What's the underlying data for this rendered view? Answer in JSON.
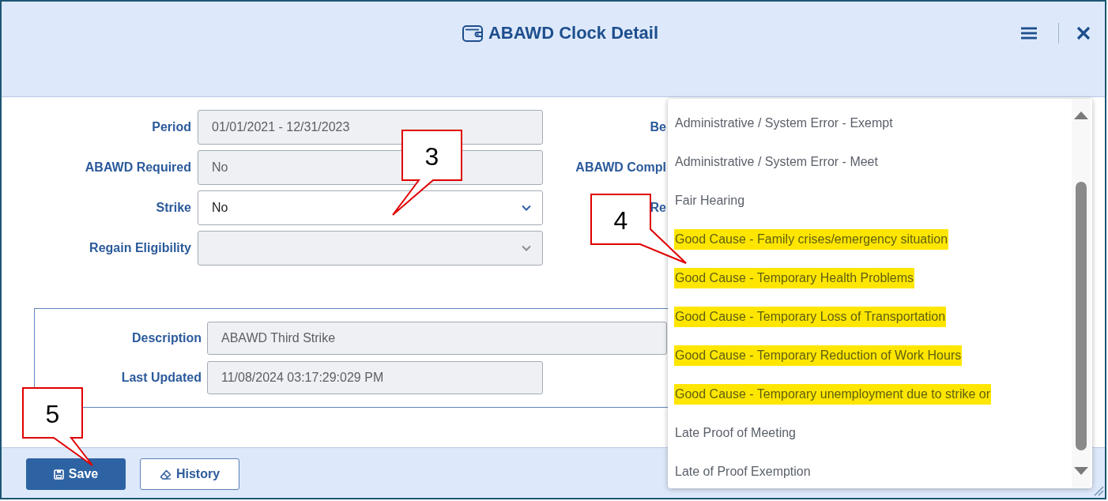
{
  "window": {
    "title": "ABAWD Clock Detail"
  },
  "form": {
    "fields": [
      {
        "label": "Period",
        "kind": "text",
        "value": "01/01/2021 - 12/31/2023",
        "disabled": true
      },
      {
        "label": "ABAWD Required",
        "kind": "text",
        "value": "No",
        "disabled": true
      },
      {
        "label": "Strike",
        "kind": "select",
        "value": "No",
        "disabled": false
      },
      {
        "label": "Regain Eligibility",
        "kind": "select",
        "disabled": true
      }
    ],
    "column_2_labels": [
      "Be",
      "ABAWD Compl",
      "Re"
    ]
  },
  "details": {
    "fields": [
      {
        "label": "Description",
        "value": "ABAWD Third Strike",
        "disabled": true
      },
      {
        "label": "Last Updated",
        "value": "11/08/2024 03:17:29:029 PM",
        "disabled": true
      }
    ]
  },
  "footer": {
    "buttons": [
      {
        "label": "Save",
        "kind": "primary"
      },
      {
        "label": "History",
        "kind": "secondary"
      }
    ]
  },
  "dropdown": {
    "options": [
      {
        "label": "Administrative / System Error - Exempt",
        "highlighted": false
      },
      {
        "label": "Administrative / System Error - Meet",
        "highlighted": false
      },
      {
        "label": "Fair Hearing",
        "highlighted": false
      },
      {
        "label": "Good Cause - Family crises/emergency situation",
        "highlighted": true
      },
      {
        "label": "Good Cause - Temporary Health Problems",
        "highlighted": true
      },
      {
        "label": "Good Cause - Temporary Loss of Transportation",
        "highlighted": true
      },
      {
        "label": "Good Cause - Temporary Reduction of Work Hours",
        "highlighted": true
      },
      {
        "label": "Good Cause - Temporary unemployment due to strike or",
        "highlighted": true
      },
      {
        "label": "Late Proof of Meeting",
        "highlighted": false
      },
      {
        "label": "Late of Proof Exemption",
        "highlighted": false
      }
    ]
  },
  "callouts": [
    {
      "label": "3"
    },
    {
      "label": "4"
    },
    {
      "label": "5"
    }
  ]
}
